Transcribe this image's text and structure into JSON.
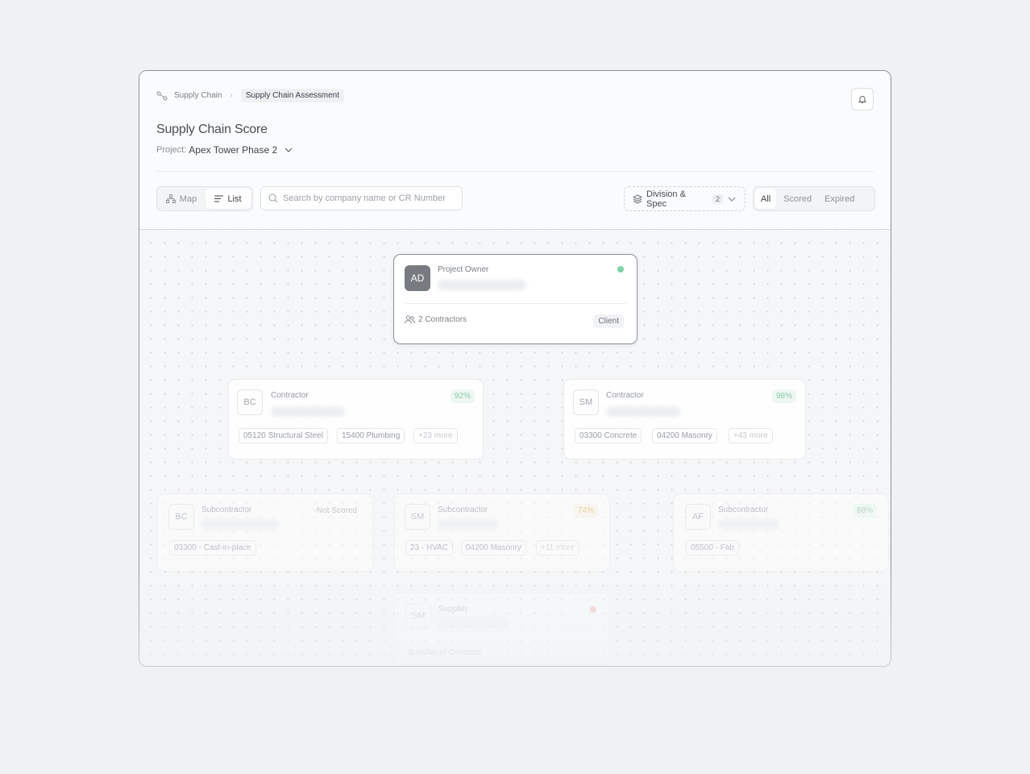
{
  "breadcrumb": {
    "root": "Supply Chain",
    "current": "Supply Chain Assessment"
  },
  "header": {
    "title": "Supply Chain Score",
    "project_label": "Project:",
    "project_name": "Apex Tower Phase 2"
  },
  "toolbar": {
    "view_map": "Map",
    "view_list": "List",
    "search_placeholder": "Search by company name or CR Number",
    "division_label": "Division & Spec",
    "division_count": "2",
    "filters": [
      "All",
      "Scored",
      "Expired"
    ]
  },
  "owner_card": {
    "initials": "AD",
    "role": "Project Owner",
    "contractors": "2 Contractors",
    "badge": "Client",
    "status_color": "#7fd3a5"
  },
  "contractors": [
    {
      "initials": "BC",
      "role": "Contractor",
      "score": "92%",
      "tags": [
        "05120 Structural Steel",
        "15400 Plumbing",
        "+23 more"
      ]
    },
    {
      "initials": "SM",
      "role": "Contractor",
      "score": "98%",
      "tags": [
        "03300 Concrete",
        "04200 Masonry",
        "+43 more"
      ]
    }
  ],
  "subcontractors": [
    {
      "initials": "BC",
      "role": "Subcontractor",
      "score": "-Not Scored",
      "tags": [
        "03300 - Cast-in-place"
      ]
    },
    {
      "initials": "SM",
      "role": "Subcontractor",
      "score": "74%",
      "tags": [
        "23 - HVAC",
        "04200 Masonry",
        "+11 more"
      ]
    },
    {
      "initials": "AF",
      "role": "Subcontractor",
      "score": "88%",
      "tags": [
        "05500 - Fab"
      ]
    }
  ],
  "supplier": {
    "initials": "SM",
    "role": "Supplier",
    "footer": "Supplier of Concrete"
  }
}
